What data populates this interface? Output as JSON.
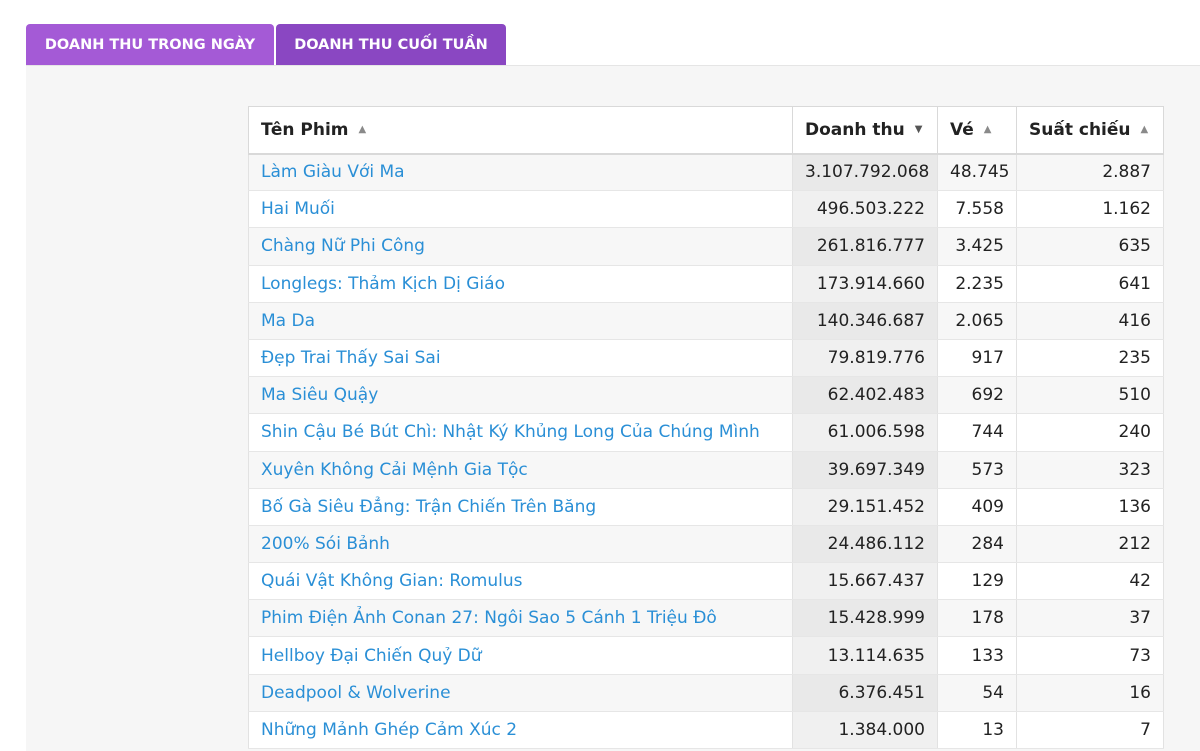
{
  "tabs": [
    {
      "label": "DOANH THU TRONG NGÀY"
    },
    {
      "label": "DOANH THU CUỐI TUẦN"
    }
  ],
  "table": {
    "headers": {
      "name": "Tên Phim",
      "revenue": "Doanh thu",
      "tickets": "Vé",
      "showings": "Suất chiếu"
    },
    "sort": {
      "column": "revenue",
      "direction": "descending"
    },
    "rows": [
      {
        "name": "Làm Giàu Với Ma",
        "revenue": "3.107.792.068",
        "tickets": "48.745",
        "showings": "2.887"
      },
      {
        "name": "Hai Muối",
        "revenue": "496.503.222",
        "tickets": "7.558",
        "showings": "1.162"
      },
      {
        "name": "Chàng Nữ Phi Công",
        "revenue": "261.816.777",
        "tickets": "3.425",
        "showings": "635"
      },
      {
        "name": "Longlegs: Thảm Kịch Dị Giáo",
        "revenue": "173.914.660",
        "tickets": "2.235",
        "showings": "641"
      },
      {
        "name": "Ma Da",
        "revenue": "140.346.687",
        "tickets": "2.065",
        "showings": "416"
      },
      {
        "name": "Đẹp Trai Thấy Sai Sai",
        "revenue": "79.819.776",
        "tickets": "917",
        "showings": "235"
      },
      {
        "name": "Ma Siêu Quậy",
        "revenue": "62.402.483",
        "tickets": "692",
        "showings": "510"
      },
      {
        "name": "Shin Cậu Bé Bút Chì: Nhật Ký Khủng Long Của Chúng Mình",
        "revenue": "61.006.598",
        "tickets": "744",
        "showings": "240"
      },
      {
        "name": "Xuyên Không Cải Mệnh Gia Tộc",
        "revenue": "39.697.349",
        "tickets": "573",
        "showings": "323"
      },
      {
        "name": "Bố Gà Siêu Đẳng: Trận Chiến Trên Băng",
        "revenue": "29.151.452",
        "tickets": "409",
        "showings": "136"
      },
      {
        "name": "200% Sói Bảnh",
        "revenue": "24.486.112",
        "tickets": "284",
        "showings": "212"
      },
      {
        "name": "Quái Vật Không Gian: Romulus",
        "revenue": "15.667.437",
        "tickets": "129",
        "showings": "42"
      },
      {
        "name": "Phim Điện Ảnh Conan 27: Ngôi Sao 5 Cánh 1 Triệu Đô",
        "revenue": "15.428.999",
        "tickets": "178",
        "showings": "37"
      },
      {
        "name": "Hellboy Đại Chiến Quỷ Dữ",
        "revenue": "13.114.635",
        "tickets": "133",
        "showings": "73"
      },
      {
        "name": "Deadpool & Wolverine",
        "revenue": "6.376.451",
        "tickets": "54",
        "showings": "16"
      },
      {
        "name": "Những Mảnh Ghép Cảm Xúc 2",
        "revenue": "1.384.000",
        "tickets": "13",
        "showings": "7"
      }
    ]
  },
  "icons": {
    "sort_asc": "sort-ascending-icon",
    "sort_desc": "sort-descending-icon"
  },
  "colors": {
    "tab_active": "#a45ad6",
    "tab_inactive": "#8a47c2",
    "link": "#2a8fd6"
  }
}
